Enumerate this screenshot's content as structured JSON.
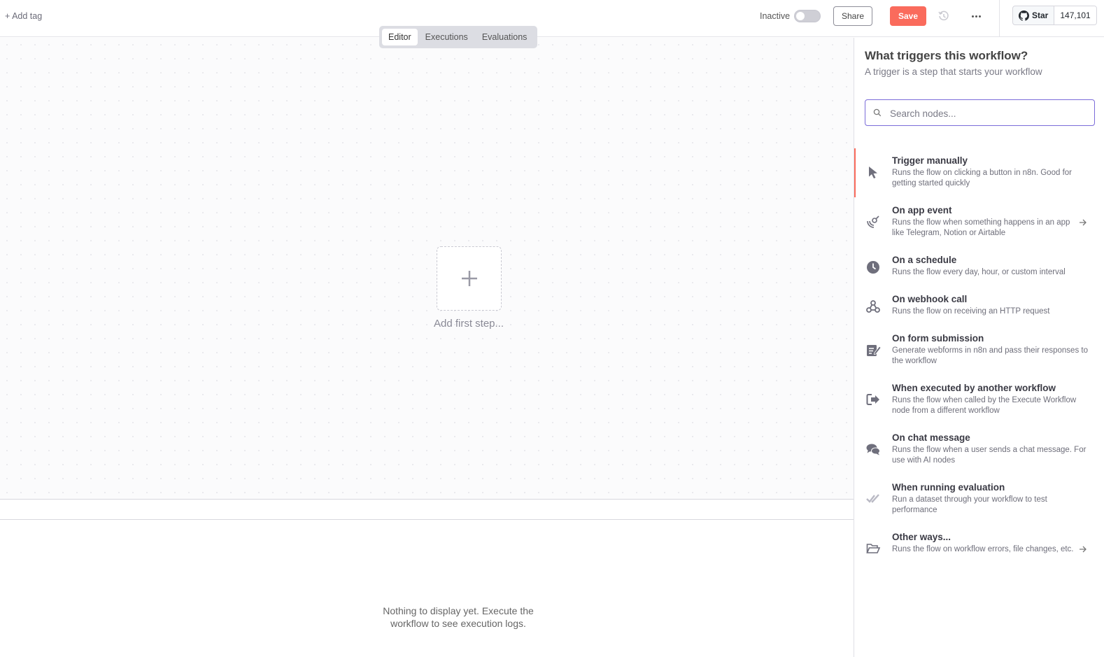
{
  "header": {
    "add_tag": "+ Add tag",
    "active_label": "Inactive",
    "share_label": "Share",
    "save_label": "Save",
    "github_star_label": "Star",
    "github_star_count": "147,101"
  },
  "tabs": [
    {
      "label": "Editor",
      "active": true
    },
    {
      "label": "Executions",
      "active": false
    },
    {
      "label": "Evaluations",
      "active": false
    }
  ],
  "canvas": {
    "add_first_step": "Add first step..."
  },
  "logs": {
    "empty_text": "Nothing to display yet. Execute the workflow to see execution logs."
  },
  "panel": {
    "title": "What triggers this workflow?",
    "subtitle": "A trigger is a step that starts your workflow",
    "search_placeholder": "Search nodes...",
    "triggers": [
      {
        "title": "Trigger manually",
        "desc": "Runs the flow on clicking a button in n8n. Good for getting started quickly",
        "icon": "cursor-icon",
        "arrow": false,
        "selected": true
      },
      {
        "title": "On app event",
        "desc": "Runs the flow when something happens in an app like Telegram, Notion or Airtable",
        "icon": "satellite-icon",
        "arrow": true,
        "selected": false
      },
      {
        "title": "On a schedule",
        "desc": "Runs the flow every day, hour, or custom interval",
        "icon": "clock-icon",
        "arrow": false,
        "selected": false
      },
      {
        "title": "On webhook call",
        "desc": "Runs the flow on receiving an HTTP request",
        "icon": "webhook-icon",
        "arrow": false,
        "selected": false
      },
      {
        "title": "On form submission",
        "desc": "Generate webforms in n8n and pass their responses to the workflow",
        "icon": "form-icon",
        "arrow": false,
        "selected": false
      },
      {
        "title": "When executed by another workflow",
        "desc": "Runs the flow when called by the Execute Workflow node from a different workflow",
        "icon": "sign-in-icon",
        "arrow": false,
        "selected": false
      },
      {
        "title": "On chat message",
        "desc": "Runs the flow when a user sends a chat message. For use with AI nodes",
        "icon": "chat-icon",
        "arrow": false,
        "selected": false
      },
      {
        "title": "When running evaluation",
        "desc": "Run a dataset through your workflow to test performance",
        "icon": "check-double-icon",
        "arrow": false,
        "selected": false
      },
      {
        "title": "Other ways...",
        "desc": "Runs the flow on workflow errors, file changes, etc.",
        "icon": "folder-open-icon",
        "arrow": true,
        "selected": false
      }
    ]
  },
  "colors": {
    "accent": "#fa6b5c",
    "search_border": "#7b6cd9"
  }
}
